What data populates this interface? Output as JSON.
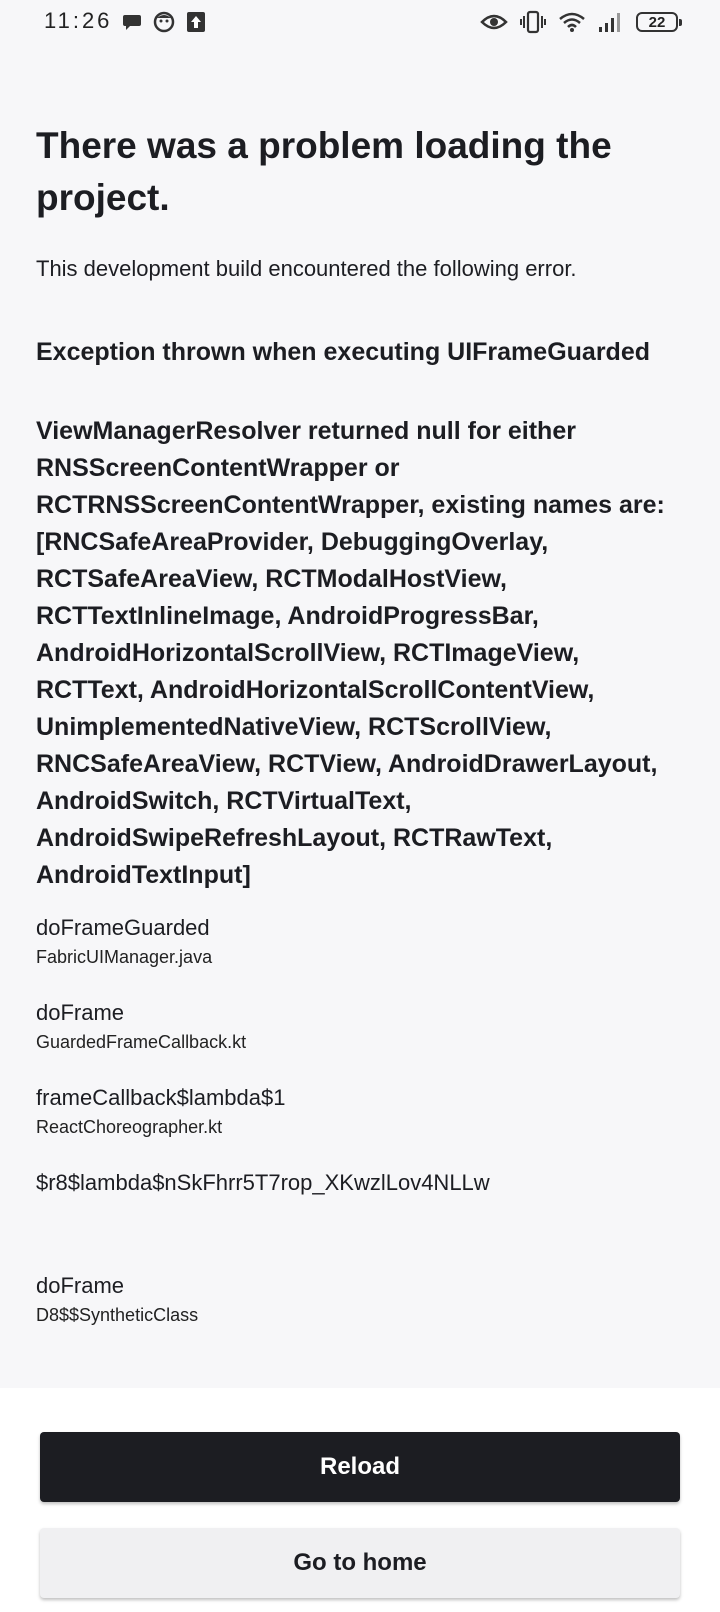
{
  "status_bar": {
    "time": "11:26",
    "battery": "22",
    "left_icons": [
      "chat-bubble-icon",
      "face-icon",
      "upload-icon"
    ],
    "right_icons": [
      "eye-icon",
      "vibrate-icon",
      "wifi-icon",
      "signal-icon"
    ]
  },
  "error": {
    "title": "There was a problem loading the project.",
    "subtitle": "This development build encountered the following error.",
    "heading": "Exception thrown when executing UIFrameGuarded",
    "message": "ViewManagerResolver returned null for either RNSScreenContentWrapper or RCTRNSScreenContentWrapper, existing names are: [RNCSafeAreaProvider, DebuggingOverlay, RCTSafeAreaView, RCTModalHostView, RCTTextInlineImage, AndroidProgressBar, AndroidHorizontalScrollView, RCTImageView, RCTText, AndroidHorizontalScrollContentView, UnimplementedNativeView, RCTScrollView, RNCSafeAreaView, RCTView, AndroidDrawerLayout, AndroidSwitch, RCTVirtualText, AndroidSwipeRefreshLayout, RCTRawText, AndroidTextInput]"
  },
  "stack_frames": [
    {
      "method": "doFrameGuarded",
      "file": "FabricUIManager.java"
    },
    {
      "method": "doFrame",
      "file": "GuardedFrameCallback.kt"
    },
    {
      "method": "frameCallback$lambda$1",
      "file": "ReactChoreographer.kt"
    },
    {
      "method": "$r8$lambda$nSkFhrr5T7rop_XKwzlLov4NLLw",
      "file": ""
    },
    {
      "method": "doFrame",
      "file": "D8$$SyntheticClass"
    }
  ],
  "actions": {
    "reload_label": "Reload",
    "home_label": "Go to home"
  },
  "colors": {
    "background": "#f7f7f9",
    "primary_button": "#1c1d22",
    "secondary_button": "#f0f0f2"
  }
}
